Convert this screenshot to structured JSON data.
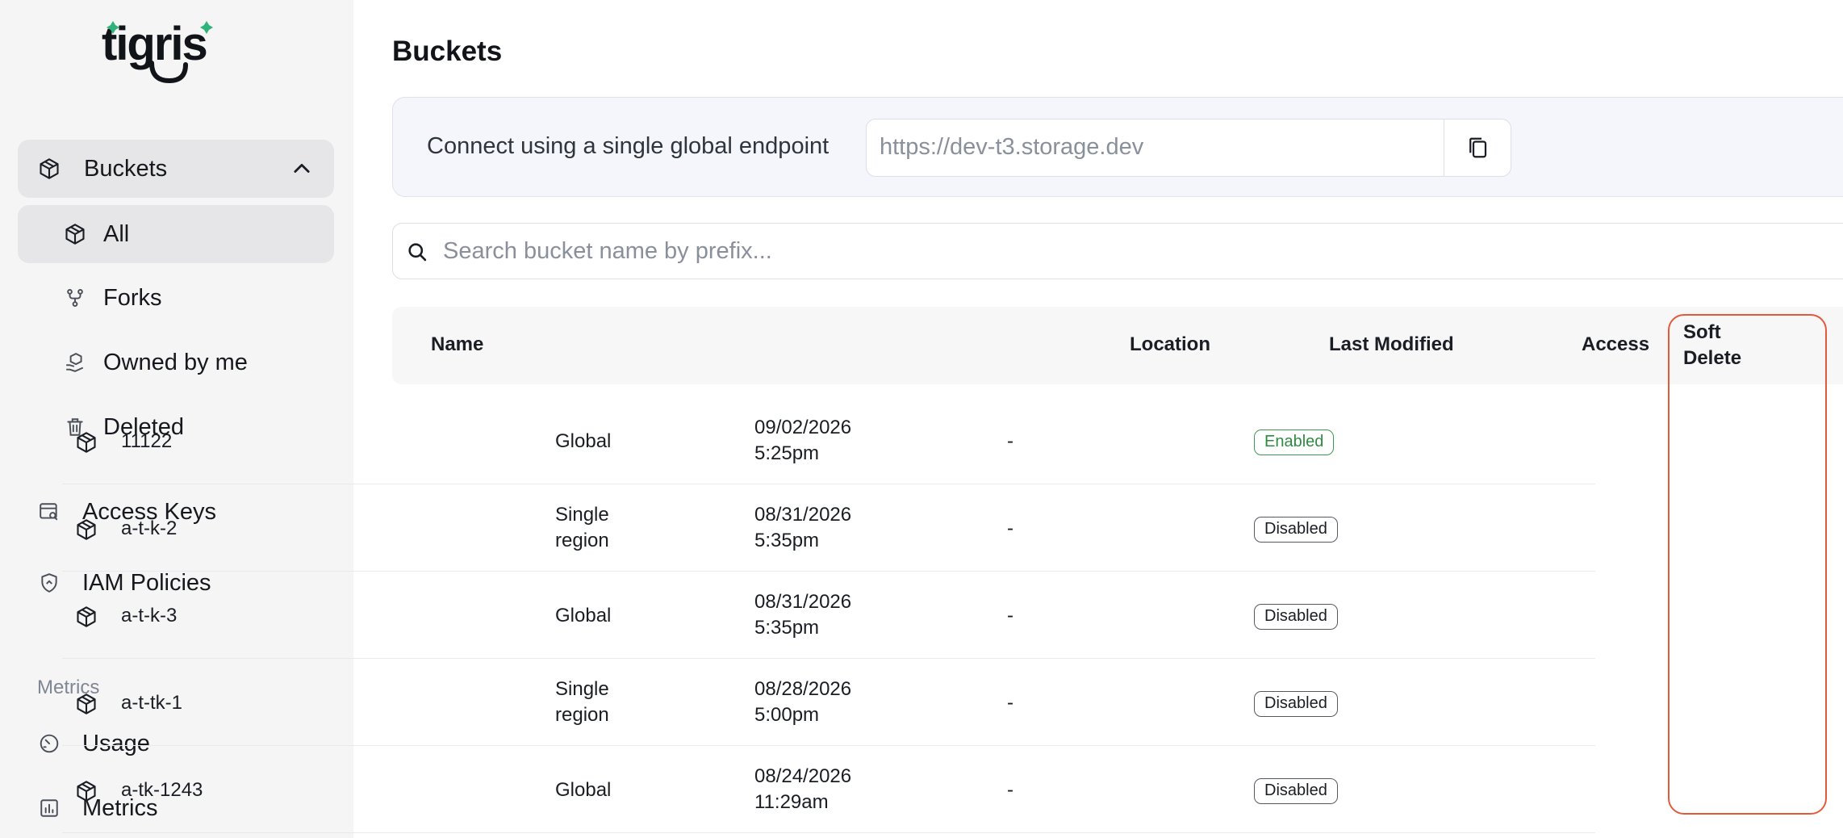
{
  "sidebar": {
    "logo_text": "tigris",
    "buckets_label": "Buckets",
    "all_label": "All",
    "forks_label": "Forks",
    "owned_label": "Owned by me",
    "deleted_label": "Deleted",
    "access_keys_label": "Access Keys",
    "iam_label": "IAM Policies",
    "metrics_section": "Metrics",
    "usage_label": "Usage",
    "metrics_label": "Metrics"
  },
  "main": {
    "title": "Buckets",
    "endpoint_label": "Connect using a single global endpoint",
    "endpoint_value": "https://dev-t3.storage.dev",
    "search_placeholder": "Search bucket name by prefix..."
  },
  "table": {
    "headers": {
      "name": "Name",
      "location": "Location",
      "modified": "Last Modified",
      "access": "Access",
      "soft1": "Soft",
      "soft2": "Delete"
    },
    "rows": [
      {
        "name": "11122",
        "loc1": "Global",
        "loc2": "",
        "date": "09/02/2026",
        "time": "5:25pm",
        "access": "-",
        "status": "Enabled"
      },
      {
        "name": "a-t-k-2",
        "loc1": "Single",
        "loc2": "region",
        "date": "08/31/2026",
        "time": "5:35pm",
        "access": "-",
        "status": "Disabled"
      },
      {
        "name": "a-t-k-3",
        "loc1": "Global",
        "loc2": "",
        "date": "08/31/2026",
        "time": "5:35pm",
        "access": "-",
        "status": "Disabled"
      },
      {
        "name": "a-t-tk-1",
        "loc1": "Single",
        "loc2": "region",
        "date": "08/28/2026",
        "time": "5:00pm",
        "access": "-",
        "status": "Disabled"
      },
      {
        "name": "a-tk-1243",
        "loc1": "Global",
        "loc2": "",
        "date": "08/24/2026",
        "time": "11:29am",
        "access": "-",
        "status": "Disabled"
      }
    ]
  },
  "colors": {
    "accent": "#2fb37a",
    "highlight": "#e35a3a",
    "enabled": "#3e9a50"
  }
}
